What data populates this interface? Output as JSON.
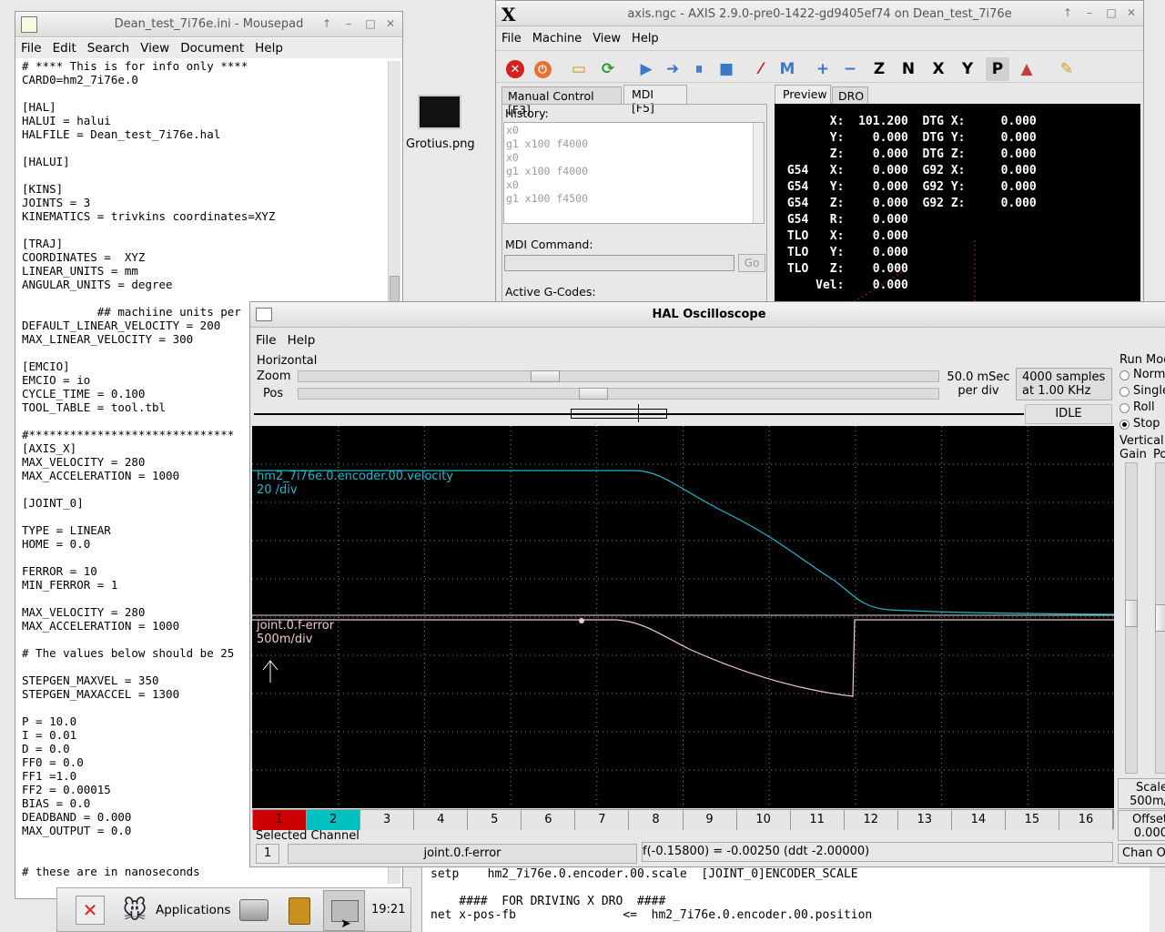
{
  "mousepad": {
    "title": "Dean_test_7i76e.ini - Mousepad",
    "menu": [
      "File",
      "Edit",
      "Search",
      "View",
      "Document",
      "Help"
    ],
    "lines": [
      "# **** This is for info only ****",
      "CARD0=hm2_7i76e.0",
      "",
      "[HAL]",
      "HALUI = halui",
      "HALFILE = Dean_test_7i76e.hal",
      "",
      "[HALUI]",
      "",
      "[KINS]",
      "JOINTS = 3",
      "KINEMATICS = trivkins coordinates=XYZ",
      "",
      "[TRAJ]",
      "COORDINATES =  XYZ",
      "LINEAR_UNITS = mm",
      "ANGULAR_UNITS = degree",
      "",
      "           ## machiine units per",
      "DEFAULT_LINEAR_VELOCITY = 200",
      "MAX_LINEAR_VELOCITY = 300",
      "",
      "[EMCIO]",
      "EMCIO = io",
      "CYCLE_TIME = 0.100",
      "TOOL_TABLE = tool.tbl",
      "",
      "#******************************",
      "[AXIS_X]",
      "MAX_VELOCITY = 280",
      "MAX_ACCELERATION = 1000",
      "",
      "[JOINT_0]",
      "",
      "TYPE = LINEAR",
      "HOME = 0.0",
      "",
      "FERROR = 10",
      "MIN_FERROR = 1",
      "",
      "MAX_VELOCITY = 280",
      "MAX_ACCELERATION = 1000",
      "",
      "# The values below should be 25",
      "",
      "STEPGEN_MAXVEL = 350",
      "STEPGEN_MAXACCEL = 1300",
      "",
      "P = 10.0",
      "I = 0.01",
      "D = 0.0",
      "FF0 = 0.0",
      "FF1 =1.0",
      "FF2 = 0.00015",
      "BIAS = 0.0",
      "DEADBAND = 0.000",
      "MAX_OUTPUT = 0.0",
      "",
      "",
      "# these are in nanoseconds"
    ]
  },
  "desktop": {
    "file_label": "Grotius.png"
  },
  "axis": {
    "title": "axis.ngc - AXIS 2.9.0-pre0-1422-gd9405ef74 on Dean_test_7i76e",
    "menu": [
      "File",
      "Machine",
      "View",
      "Help"
    ],
    "tabs": [
      "Manual Control [F3]",
      "MDI [F5]"
    ],
    "right_tabs": [
      "Preview",
      "DRO"
    ],
    "history_label": "History:",
    "history": [
      "x0",
      "g1 x100 f4000",
      "x0",
      "g1 x100 f4000",
      "x0",
      "g1 x100 f4500"
    ],
    "mdi_label": "MDI Command:",
    "mdi_value": "",
    "go_label": "Go",
    "active_gcodes_label": "Active G-Codes:",
    "dro": [
      [
        "",
        "X:",
        "101.200",
        "DTG X:",
        "0.000"
      ],
      [
        "",
        "Y:",
        "0.000",
        "DTG Y:",
        "0.000"
      ],
      [
        "",
        "Z:",
        "0.000",
        "DTG Z:",
        "0.000"
      ],
      [
        "G54",
        "X:",
        "0.000",
        "G92 X:",
        "0.000"
      ],
      [
        "G54",
        "Y:",
        "0.000",
        "G92 Y:",
        "0.000"
      ],
      [
        "G54",
        "Z:",
        "0.000",
        "G92 Z:",
        "0.000"
      ],
      [
        "G54",
        "R:",
        "0.000",
        "",
        ""
      ],
      [
        "TLO",
        "X:",
        "0.000",
        "",
        ""
      ],
      [
        "TLO",
        "Y:",
        "0.000",
        "",
        ""
      ],
      [
        "TLO",
        "Z:",
        "0.000",
        "",
        ""
      ],
      [
        "",
        "Vel:",
        "0.000",
        "",
        ""
      ]
    ]
  },
  "scope": {
    "title": "HAL Oscilloscope",
    "menu": [
      "File",
      "Help"
    ],
    "horizontal_label": "Horizontal",
    "zoom_label": "Zoom",
    "pos_label": "Pos",
    "zoom_level": 0.38,
    "pos_level": 0.46,
    "rate_line1": "50.0 mSec",
    "rate_line2": "per div",
    "samples_line1": "4000 samples",
    "samples_line2": "at 1.00 KHz",
    "state": "IDLE",
    "run_mode_label": "Run Mode",
    "run_modes": [
      "Normal",
      "Single",
      "Roll",
      "Stop"
    ],
    "run_mode_selected": "Stop",
    "vertical_label": "Vertical",
    "gain_label": "Gain",
    "pos_short_label": "Po",
    "ch1_name": "hm2_7i76e.0.encoder.00.velocity",
    "ch1_scale": "20 /div",
    "ch2_name": "joint.0.f-error",
    "ch2_scale": "500m/div",
    "channels": [
      "1",
      "2",
      "3",
      "4",
      "5",
      "6",
      "7",
      "8",
      "9",
      "10",
      "11",
      "12",
      "13",
      "14",
      "15",
      "16"
    ],
    "channel_colors": {
      "1": "#cc0000",
      "2": "#00c0c0"
    },
    "selected_channel_label": "Selected Channel",
    "selected_channel_num": "1",
    "selected_channel_name": "joint.0.f-error",
    "readout": "f(-0.15800) = -0.00250 (ddt -2.00000)",
    "scale_label": "Scale",
    "scale_value": "500m/",
    "offset_label": "Offset",
    "offset_value": "0.000",
    "chan_off_label": "Chan O",
    "trace_colors": {
      "velocity": "#20b8c8",
      "ferror": "#f0c8c8"
    }
  },
  "terminal": {
    "lines": [
      "setp    hm2_7i76e.0.encoder.00.scale  [JOINT_0]ENCODER_SCALE",
      "",
      "    ####  FOR DRIVING X DRO  ####",
      "net x-pos-fb               <=  hm2_7i76e.0.encoder.00.position"
    ]
  },
  "taskbar": {
    "applications_label": "Applications",
    "clock": "19:21"
  }
}
